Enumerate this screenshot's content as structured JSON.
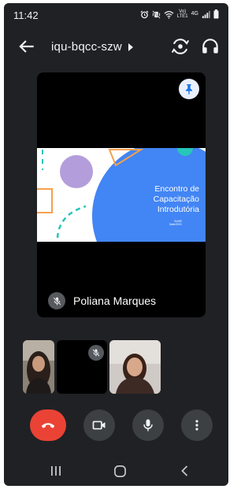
{
  "status_bar": {
    "time": "11:42",
    "network_line1": "Vo)",
    "network_line2": "LTE1",
    "network_type": "4G",
    "icons": [
      "alarm-icon",
      "vibrate-icon",
      "wifi-icon",
      "signal-icon",
      "battery-icon"
    ]
  },
  "header": {
    "meeting_code": "iqu-bqcc-szw",
    "icons": [
      "back-arrow-icon",
      "switch-camera-icon",
      "headphones-icon"
    ]
  },
  "main_tile": {
    "participant_name": "Poliana Marques",
    "slide": {
      "title_line1": "Encontro de",
      "title_line2": "Capacitação",
      "title_line3": "Introdutória",
      "subtitle_line1": "SoWE",
      "subtitle_line2": "Date/2021"
    },
    "pin_icon": "pin-icon",
    "mute_icon": "mic-off-icon"
  },
  "thumbnails": [
    {
      "kind": "video"
    },
    {
      "kind": "camera-off",
      "icon": "mic-off-icon"
    },
    {
      "kind": "video"
    }
  ],
  "controls": [
    "end-call-icon",
    "camera-icon",
    "mic-icon",
    "more-vert-icon"
  ],
  "nav_bar": [
    "recents-icon",
    "home-icon",
    "back-icon"
  ],
  "colors": {
    "background": "#202124",
    "end_call": "#ea4335",
    "control_bg": "#3c4043",
    "slide_blue": "#4285f4",
    "slide_purple": "#b39ddb",
    "slide_orange": "#f6a04d",
    "slide_teal": "#26c6b8",
    "pin_bg": "#e8f0fe"
  }
}
